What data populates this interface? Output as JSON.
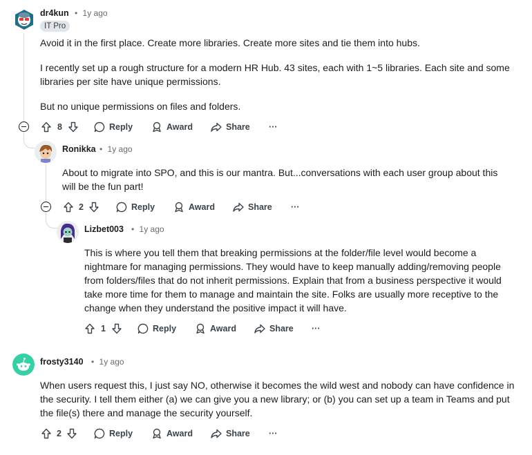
{
  "comments": [
    {
      "author": "dr4kun",
      "time": "1y ago",
      "flair": "IT Pro",
      "paragraphs": [
        "Avoid it in the first place. Create more libraries. Create more sites and tie them into hubs.",
        "I recently set up a rough structure for a modern HR Hub. 43 sites, each with 1~5 libraries. Each site and some libraries per site have unique permissions.",
        "But no unique permissions on files and folders."
      ],
      "votes": "8"
    },
    {
      "author": "Ronikka",
      "time": "1y ago",
      "paragraphs": [
        "About to migrate into SPO, and this is our mantra. But...conversations with each user group about this will be the fun part!"
      ],
      "votes": "2"
    },
    {
      "author": "Lizbet003",
      "time": "1y ago",
      "paragraphs": [
        "This is where you tell them that breaking permissions at the folder/file level would become a nightmare for managing permissions. They would have to keep manually adding/removing people from folders/files that do not inherit permissions. Explain that from a business perspective it would take more time for them to manage and maintain the site. Folks are usually more receptive to the change when they understand the positive impact it will have."
      ],
      "votes": "1"
    },
    {
      "author": "frosty3140",
      "time": "1y ago",
      "paragraphs": [
        "When users request this, I just say NO, otherwise it becomes the wild west and nobody can have confidence in the security. I tell them either (a) we can give you a new library; or (b) you can set up a team in Teams and put the file(s) there and manage the security yourself."
      ],
      "votes": "2"
    }
  ],
  "actions": {
    "reply": "Reply",
    "award": "Award",
    "share": "Share",
    "more": "···"
  },
  "separator": "•",
  "colors": {
    "text": "#1c1c1c",
    "meta": "#6b6b6b",
    "thread_line": "#d5d9dc",
    "flair_bg": "#dfe5ea",
    "frosty_avatar": "#35d0a5"
  }
}
